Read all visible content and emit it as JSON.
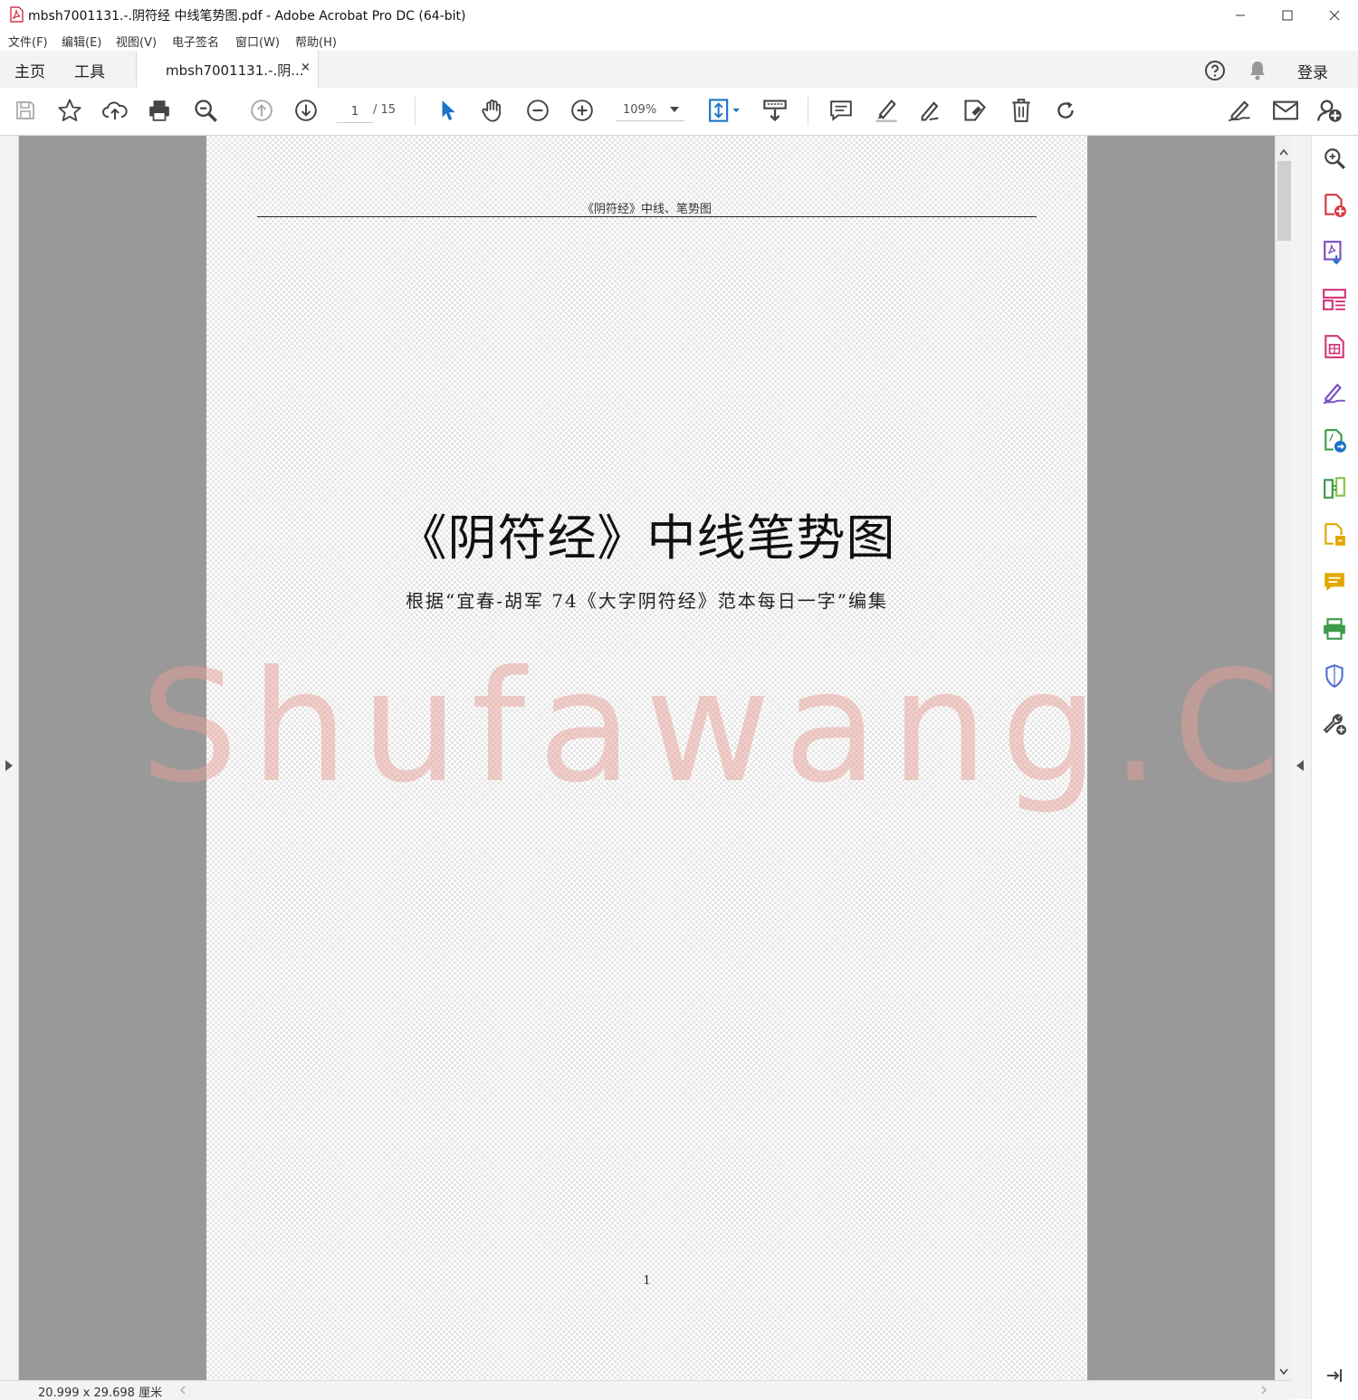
{
  "window": {
    "title": "mbsh7001131.-.阴符经 中线笔势图.pdf - Adobe Acrobat Pro DC (64-bit)",
    "app_icon": "acrobat-pdf-icon"
  },
  "menu": [
    "文件(F)",
    "编辑(E)",
    "视图(V)",
    "电子签名",
    "窗口(W)",
    "帮助(H)"
  ],
  "tabs": {
    "home": "主页",
    "tools": "工具",
    "document": "mbsh7001131.-.阴...",
    "close": "×",
    "signin": "登录"
  },
  "toolbar": {
    "page_current": "1",
    "page_total": "/ 15",
    "zoom": "109%"
  },
  "document": {
    "running_header": "《阴符经》中线、笔势图",
    "title": "《阴符经》中线笔势图",
    "subtitle": "根据“宜春-胡军 74《大字阴符经》范本每日一字”编集",
    "page_number": "1",
    "watermark": "Shufawang.CN"
  },
  "status": {
    "page_size": "20.999 x 29.698 厘米"
  },
  "colors": {
    "accent_blue": "#1a73c6",
    "red_tool": "#d9363e",
    "purple_tool": "#7b4fc4",
    "pink_tool": "#d2367a",
    "green_tool": "#3b9b4a",
    "yellow_tool": "#e0a800",
    "watermark": "#e6a096"
  }
}
